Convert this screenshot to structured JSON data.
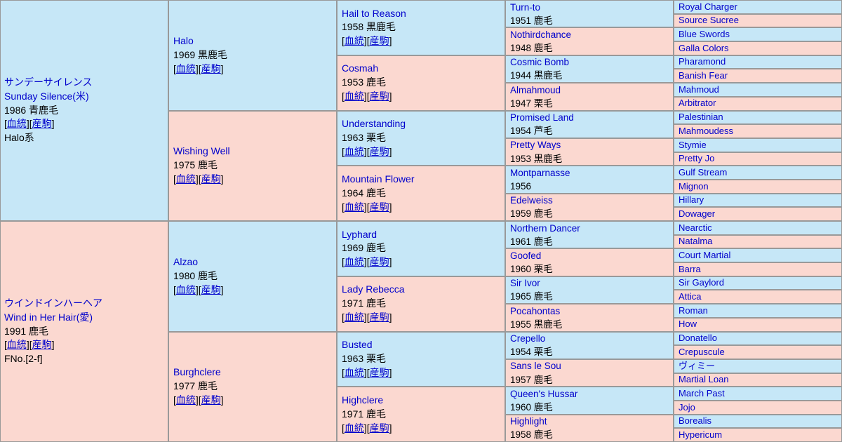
{
  "page": {
    "title": "Sunday Silence / Wind in Her Hair pedigree table",
    "colors": {
      "sire_background": "#c6e7f7",
      "dam_background": "#fbd8d0",
      "link_text": "#0000cc",
      "body_text": "#000000",
      "cell_border": "#999999"
    },
    "link_labels": {
      "pedigree": "血統",
      "offspring": "産駒",
      "open_bracket": "[",
      "close_bracket": "]"
    }
  },
  "generation1": [
    {
      "sex": "sire",
      "name_ja": "サンデーサイレンス",
      "name_en": "Sunday Silence(米)",
      "detail": "1986 青鹿毛",
      "has_links": true,
      "family_line": "Halo系"
    },
    {
      "sex": "dam",
      "name_ja": "ウインドインハーヘア",
      "name_en": "Wind in Her Hair(愛)",
      "detail": "1991 鹿毛",
      "has_links": true,
      "fno": "FNo.[2-f]"
    }
  ],
  "generation2": [
    {
      "sex": "sire",
      "name": "Halo",
      "detail": "1969 黒鹿毛",
      "has_links": true
    },
    {
      "sex": "dam",
      "name": "Wishing Well",
      "detail": "1975 鹿毛",
      "has_links": true
    },
    {
      "sex": "sire",
      "name": "Alzao",
      "detail": "1980 鹿毛",
      "has_links": true
    },
    {
      "sex": "dam",
      "name": "Burghclere",
      "detail": "1977 鹿毛",
      "has_links": true
    }
  ],
  "generation3": [
    {
      "sex": "sire",
      "name": "Hail to Reason",
      "detail": "1958 黒鹿毛",
      "has_links": true
    },
    {
      "sex": "dam",
      "name": "Cosmah",
      "detail": "1953 鹿毛",
      "has_links": true
    },
    {
      "sex": "sire",
      "name": "Understanding",
      "detail": "1963 栗毛",
      "has_links": true
    },
    {
      "sex": "dam",
      "name": "Mountain Flower",
      "detail": "1964 鹿毛",
      "has_links": true
    },
    {
      "sex": "sire",
      "name": "Lyphard",
      "detail": "1969 鹿毛",
      "has_links": true
    },
    {
      "sex": "dam",
      "name": "Lady Rebecca",
      "detail": "1971 鹿毛",
      "has_links": true
    },
    {
      "sex": "sire",
      "name": "Busted",
      "detail": "1963 栗毛",
      "has_links": true
    },
    {
      "sex": "dam",
      "name": "Highclere",
      "detail": "1971 鹿毛",
      "has_links": true
    }
  ],
  "generation4": [
    {
      "sex": "sire",
      "name": "Turn-to",
      "detail": "1951 鹿毛"
    },
    {
      "sex": "dam",
      "name": "Nothirdchance",
      "detail": "1948 鹿毛"
    },
    {
      "sex": "sire",
      "name": "Cosmic Bomb",
      "detail": "1944 黒鹿毛"
    },
    {
      "sex": "dam",
      "name": "Almahmoud",
      "detail": "1947 栗毛"
    },
    {
      "sex": "sire",
      "name": "Promised Land",
      "detail": "1954 芦毛"
    },
    {
      "sex": "dam",
      "name": "Pretty Ways",
      "detail": "1953 黒鹿毛"
    },
    {
      "sex": "sire",
      "name": "Montparnasse",
      "detail": "1956"
    },
    {
      "sex": "dam",
      "name": "Edelweiss",
      "detail": "1959 鹿毛"
    },
    {
      "sex": "sire",
      "name": "Northern Dancer",
      "detail": "1961 鹿毛"
    },
    {
      "sex": "dam",
      "name": "Goofed",
      "detail": "1960 栗毛"
    },
    {
      "sex": "sire",
      "name": "Sir Ivor",
      "detail": "1965 鹿毛"
    },
    {
      "sex": "dam",
      "name": "Pocahontas",
      "detail": "1955 黒鹿毛"
    },
    {
      "sex": "sire",
      "name": "Crepello",
      "detail": "1954 栗毛"
    },
    {
      "sex": "dam",
      "name": "Sans le Sou",
      "detail": "1957 鹿毛"
    },
    {
      "sex": "sire",
      "name": "Queen's Hussar",
      "detail": "1960 鹿毛"
    },
    {
      "sex": "dam",
      "name": "Highlight",
      "detail": "1958 鹿毛"
    }
  ],
  "generation5": [
    {
      "sex": "sire",
      "name": "Royal Charger"
    },
    {
      "sex": "dam",
      "name": "Source Sucree"
    },
    {
      "sex": "sire",
      "name": "Blue Swords"
    },
    {
      "sex": "dam",
      "name": "Galla Colors"
    },
    {
      "sex": "sire",
      "name": "Pharamond"
    },
    {
      "sex": "dam",
      "name": "Banish Fear"
    },
    {
      "sex": "sire",
      "name": "Mahmoud"
    },
    {
      "sex": "dam",
      "name": "Arbitrator"
    },
    {
      "sex": "sire",
      "name": "Palestinian"
    },
    {
      "sex": "dam",
      "name": "Mahmoudess"
    },
    {
      "sex": "sire",
      "name": "Stymie"
    },
    {
      "sex": "dam",
      "name": "Pretty Jo"
    },
    {
      "sex": "sire",
      "name": "Gulf Stream"
    },
    {
      "sex": "dam",
      "name": "Mignon"
    },
    {
      "sex": "sire",
      "name": "Hillary"
    },
    {
      "sex": "dam",
      "name": "Dowager"
    },
    {
      "sex": "sire",
      "name": "Nearctic"
    },
    {
      "sex": "dam",
      "name": "Natalma"
    },
    {
      "sex": "sire",
      "name": "Court Martial"
    },
    {
      "sex": "dam",
      "name": "Barra"
    },
    {
      "sex": "sire",
      "name": "Sir Gaylord"
    },
    {
      "sex": "dam",
      "name": "Attica"
    },
    {
      "sex": "sire",
      "name": "Roman"
    },
    {
      "sex": "dam",
      "name": "How"
    },
    {
      "sex": "sire",
      "name": "Donatello"
    },
    {
      "sex": "dam",
      "name": "Crepuscule"
    },
    {
      "sex": "sire",
      "name": "ヴィミー"
    },
    {
      "sex": "dam",
      "name": "Martial Loan"
    },
    {
      "sex": "sire",
      "name": "March Past"
    },
    {
      "sex": "dam",
      "name": "Jojo"
    },
    {
      "sex": "sire",
      "name": "Borealis"
    },
    {
      "sex": "dam",
      "name": "Hypericum"
    }
  ]
}
